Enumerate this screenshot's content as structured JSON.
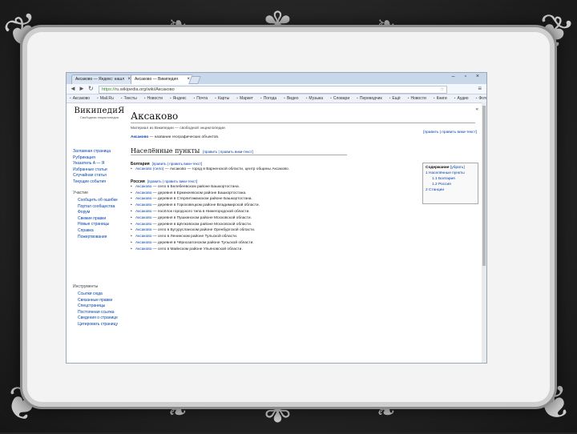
{
  "browser": {
    "tabs": [
      {
        "label": "Аксаково — Яндекс: нашл",
        "active": false
      },
      {
        "label": "Аксаково — Википедия",
        "active": true
      }
    ],
    "url_prefix": "https://",
    "url": "ru.wikipedia.org/wiki/Аксаково",
    "bookmarks": [
      "Аксаково",
      "Mail.Ru",
      "Тексты",
      "Новости",
      "Яндекс",
      "Почта",
      "Карты",
      "Маркет",
      "Погода",
      "Видео",
      "Музыка",
      "Словари",
      "Переводчик",
      "Ещё",
      "Новости",
      "Книги",
      "Аудио",
      "Фото",
      "Проекты"
    ],
    "controls": {
      "back": "◄",
      "forward": "►",
      "reload": "↻",
      "menu": "🔧",
      "window": "– ▫ ×"
    }
  },
  "wiki": {
    "logo_name": "ВикипедиЯ",
    "logo_sub": "Свободная энциклопедия",
    "nav": [
      "Заглавная страница",
      "Рубрикация",
      "Указатель А — Я",
      "Избранные статьи",
      "Случайная статья",
      "Текущие события"
    ],
    "participation_header": "Участие",
    "participation": [
      "Сообщить об ошибке",
      "Портал сообщества",
      "Форум",
      "Свежие правки",
      "Новые страницы",
      "Справка",
      "Пожертвования"
    ],
    "tools_header": "Инструменты",
    "tools": [
      "Ссылки сюда",
      "Связанные правки",
      "Спецстраницы",
      "Постоянная ссылка",
      "Сведения о странице",
      "Цитировать страницу"
    ],
    "title": "Аксаково",
    "tagline": "Материал из Википедии — свободной энциклопедии",
    "edit_all": "[править | править вики-текст]",
    "intro_bold": "Аксаково",
    "intro_rest": " — название географических объектов.",
    "section": "Населённые пункты",
    "section_edit": "[править | править вики-текст]",
    "toc": {
      "title": "Содержание",
      "hide": "[убрать]",
      "items": [
        "1 Населённые пункты",
        "1.1 Болгария",
        "1.2 Россия",
        "2 Станции"
      ]
    },
    "bulgaria": {
      "name": "Болгария",
      "edit": "[править | править вики-текст]",
      "items": [
        {
          "link": "Аксаково (село)",
          "text": " — Аксаково — город в Варненской области, центр общины Аксаково."
        }
      ]
    },
    "russia": {
      "name": "Россия",
      "edit": "[править | править вики-текст]",
      "items": [
        {
          "link": "Аксаково",
          "text": " — село в Белебеевском районе Башкортостана."
        },
        {
          "link": "Аксаково",
          "text": " — деревня в Ермекеевском районе Башкортостана."
        },
        {
          "link": "Аксаково",
          "text": " — деревня в Стерлитамакском районе Башкортостана."
        },
        {
          "link": "Аксаково",
          "text": " — деревня в Гороховецком районе Владимирской области."
        },
        {
          "link": "Аксаково",
          "text": " — посёлок городского типа в Нижегородской области."
        },
        {
          "link": "Аксаково",
          "text": " — деревня в Пушкинском районе Московской области."
        },
        {
          "link": "Аксаково",
          "text": " — деревня в Щёлковском районе Московской области."
        },
        {
          "link": "Аксаково",
          "text": " — село в Бугурусланском районе Оренбургской области."
        },
        {
          "link": "Аксаково",
          "text": " — село в Ленинском районе Тульской области."
        },
        {
          "link": "Аксаково",
          "text": " — деревня в Чёрнозатонском районе Тульской области."
        },
        {
          "link": "Аксаково",
          "text": " — село в Майнском районе Ульяновской области."
        }
      ]
    }
  },
  "colors": {
    "link": "#0645ad",
    "redlink": "#ba0000",
    "chrome_tab": "#c9d7ea",
    "frame": "#f3f3f3"
  }
}
